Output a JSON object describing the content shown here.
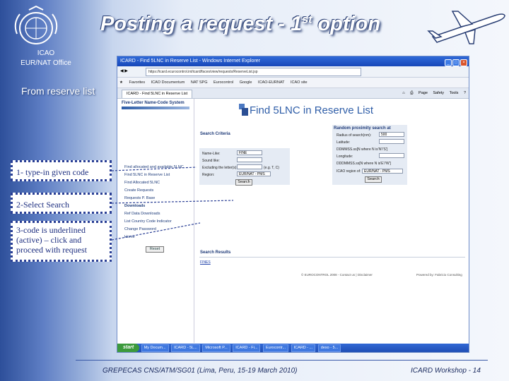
{
  "slide": {
    "title": "Posting a request - 1",
    "title_sup": "st",
    "title_tail": " option",
    "org_line1": "ICAO",
    "org_line2": "EUR/NAT Office",
    "subtitle": "From reserve list",
    "callouts": [
      "1- type-in given code",
      "2-Select Search",
      "3-code is underlined (active) – click and proceed with request"
    ],
    "footer_left": "GREPECAS CNS/ATM/SG01 (Lima, Peru, 15-19 March 2010)",
    "footer_right": "ICARD Workshop - 14",
    "colors": {
      "callout_border": "#2a3f95",
      "title_text": "#ffffff",
      "background_dark": "#2d4f9a"
    }
  },
  "browser": {
    "window_title": "ICARD - Find 5LNC in Reserve List - Windows Internet Explorer",
    "address": "https://icard.ecurocontrol.int/icard/faces/view/requests/ReserveList.jsp",
    "favorites": [
      "Favorites",
      "ICAO Documentum",
      "NAT SPG",
      "Eurocontrol",
      "Google",
      "ICAO-EURNAT",
      "ICAO site"
    ],
    "tab_label": "ICARD - Find 5LNC in Reserve List",
    "tools": [
      "Page",
      "Safety",
      "Tools"
    ],
    "icons": [
      "ie-icon",
      "back-icon",
      "forward-icon",
      "star-icon",
      "home-icon",
      "print-icon",
      "help-icon"
    ]
  },
  "page": {
    "nav_logo": "Five-Letter Name-Code System",
    "nav_items": [
      "Find allocated and available 5LNC",
      "Find 5LNC in Reserve List",
      "Find Allocated 5LNC",
      "Create Requests",
      "Requests P. Base",
      "Downloads",
      "Ref Data Downloads",
      "List Country Code Indicator",
      "Change Password",
      "Home"
    ],
    "heading": "Find 5LNC in Reserve List",
    "search_criteria": {
      "label": "Search Criteria",
      "fields": [
        {
          "label": "Name-Like:",
          "value": "FINE"
        },
        {
          "label": "Sound like:",
          "value": ""
        },
        {
          "label": "Excluding the letter(s):",
          "value": "",
          "hint": "(e.g. T, C)"
        },
        {
          "label": "Region:",
          "value": "EUR/NAT - PMS"
        }
      ],
      "search_button": "Search"
    },
    "proximity": {
      "label": "Random proximity search at",
      "fields": [
        {
          "label": "Radius of search(nm):",
          "value": "500"
        },
        {
          "label": "Latitude:",
          "value": ""
        },
        {
          "label": "DDMMSS.ss[N where N is'N'/'S']",
          "value": ""
        },
        {
          "label": "Longitude:",
          "value": ""
        },
        {
          "label": "DDDMMSS.ss[N where N is'E'/'W']",
          "value": ""
        },
        {
          "label": "ICAO region of:",
          "value": "EUR/NAT - PMS"
        }
      ],
      "search_button": "Search"
    },
    "reset_button": "Reset",
    "results_label": "Search Results",
    "result_code": "FINES",
    "copyright": "© EUROCONTROL 2008 - Contact us | Disclaimer",
    "powered": "Powered by: Fabricio Consulting"
  },
  "taskbar": {
    "start": "start",
    "items": [
      "My Docum...",
      "ICARD - 5L...",
      "Microsoft P...",
      "ICARD - Fi...",
      "Eurocontr...",
      "ICARD - ...",
      "deso - 5..."
    ]
  }
}
